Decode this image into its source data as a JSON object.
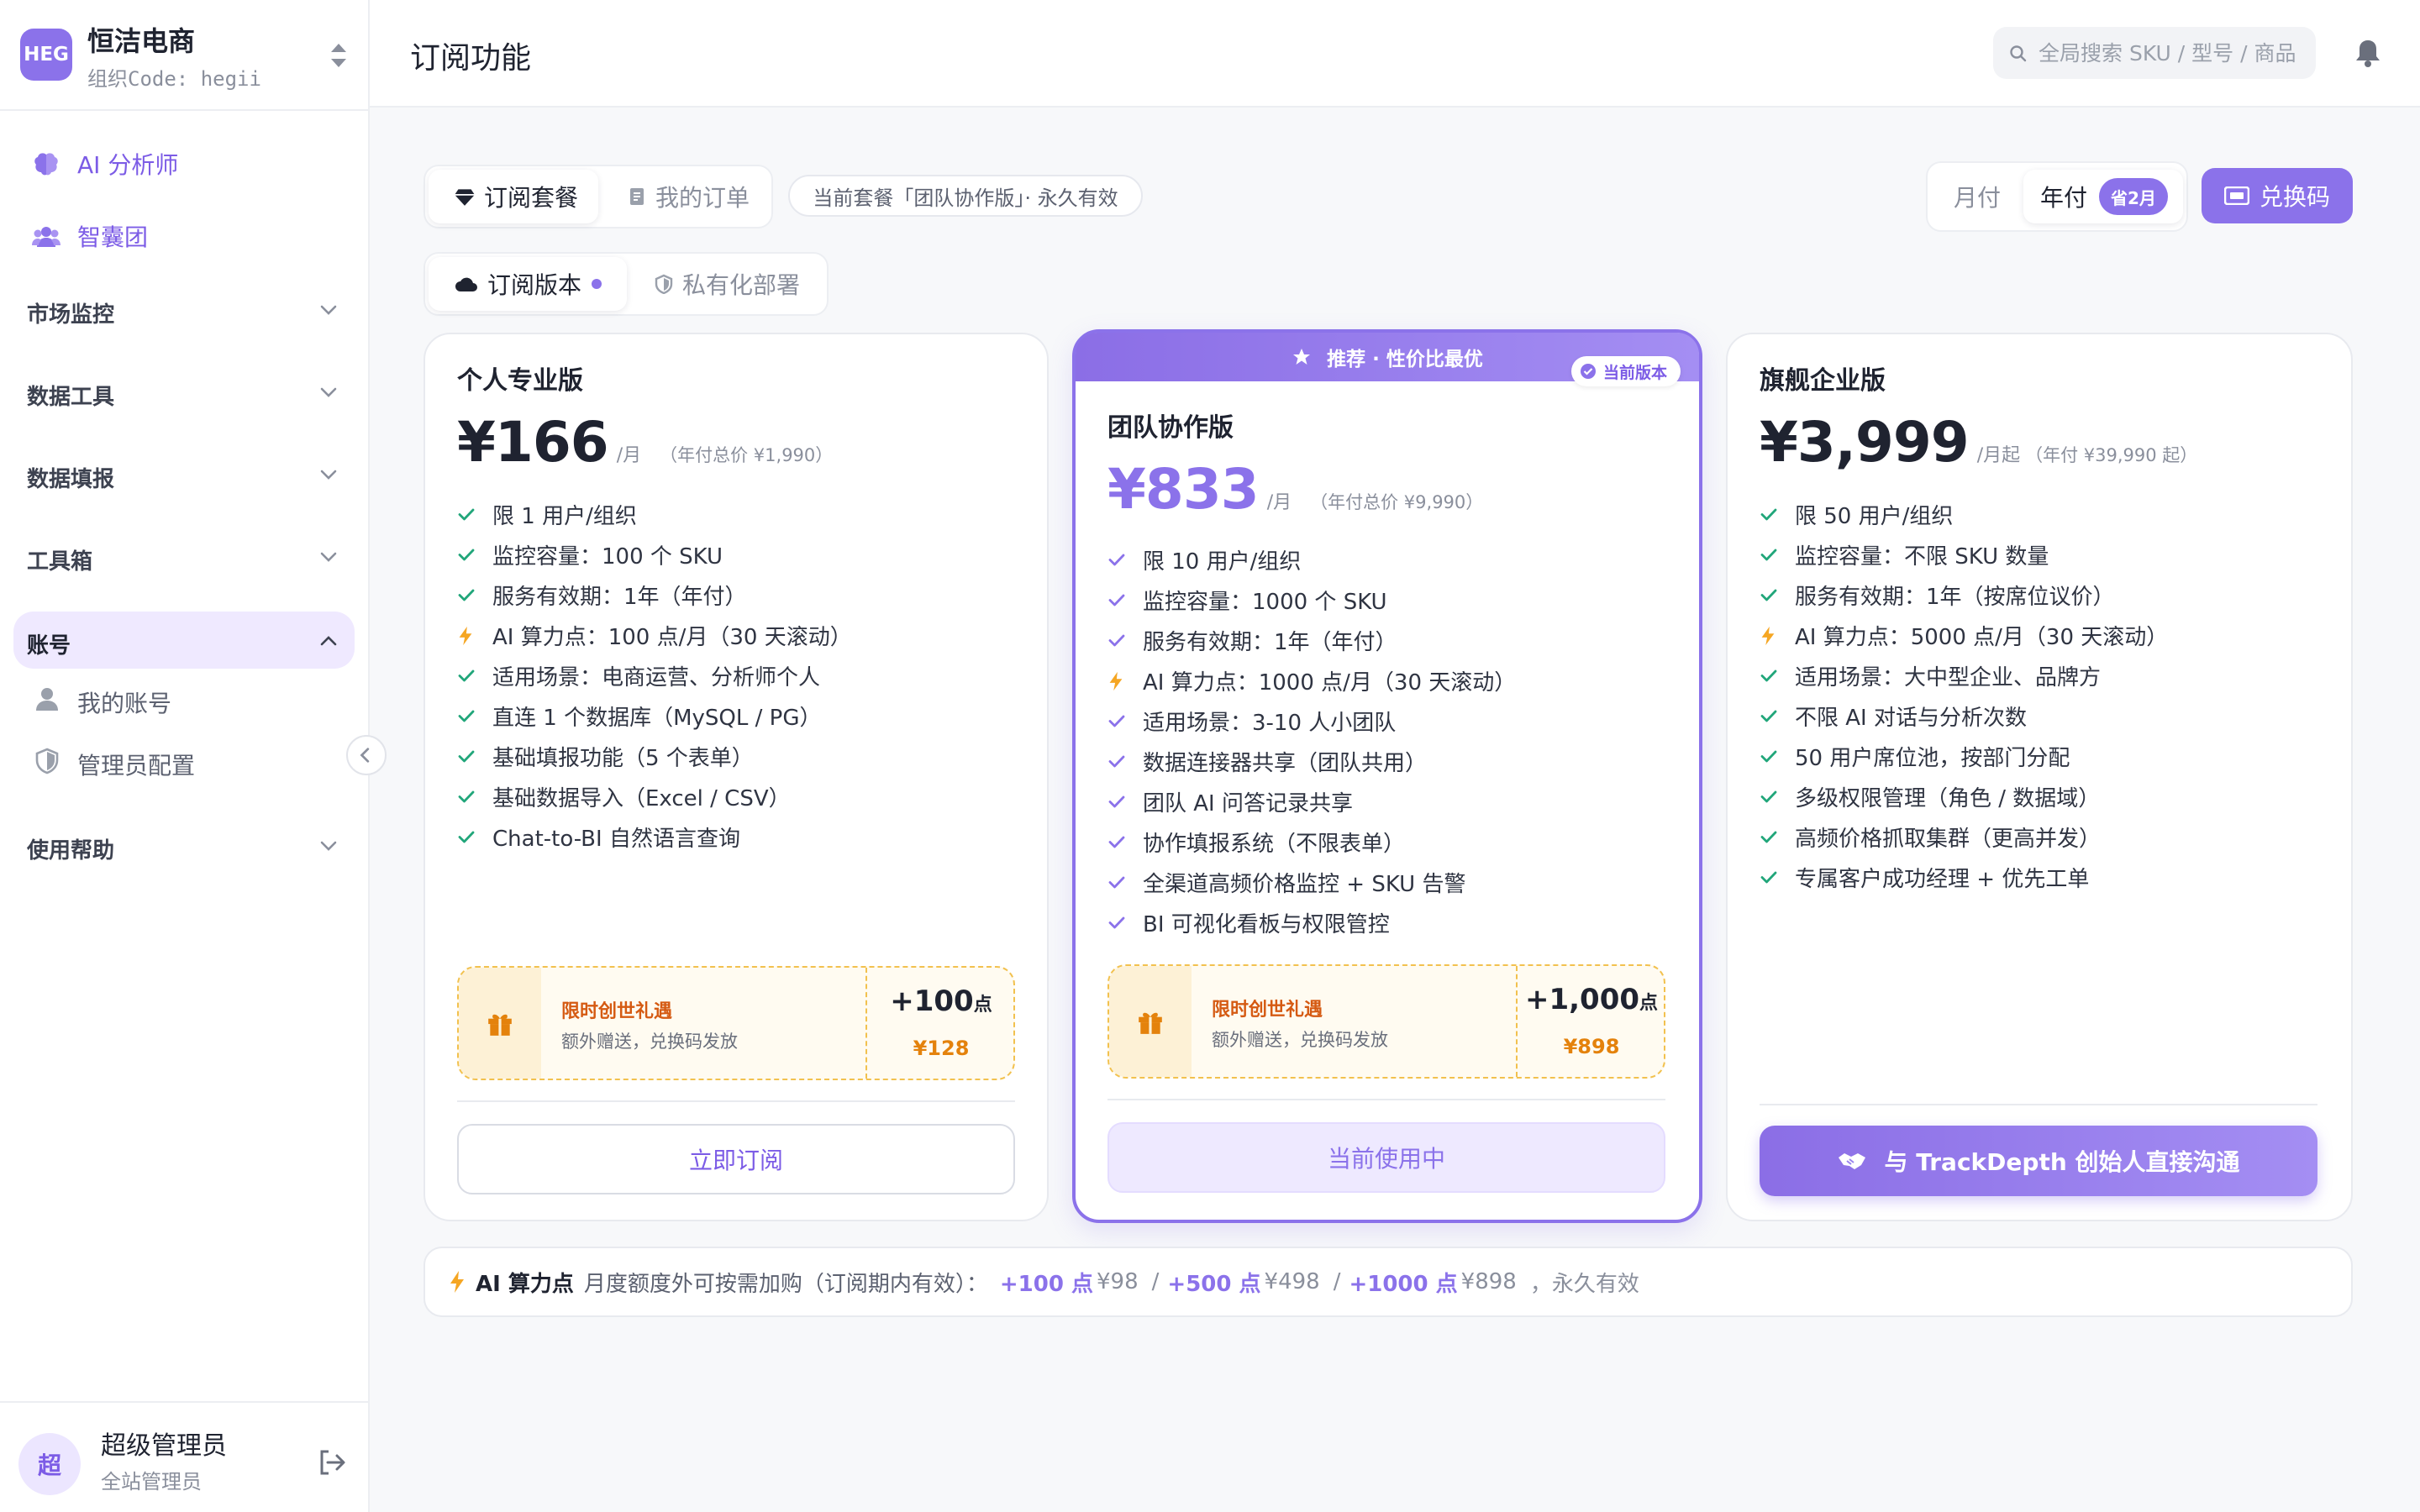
{
  "org": {
    "avatar": "HEG",
    "name": "恒洁电商",
    "code": "组织Code: hegii"
  },
  "nav": {
    "ai_analyst": "AI 分析师",
    "think_tank": "智囊团",
    "groups": {
      "market": "市场监控",
      "data_tools": "数据工具",
      "data_fill": "数据填报",
      "toolbox": "工具箱",
      "account": "账号",
      "help": "使用帮助"
    },
    "account_items": [
      "我的账号",
      "管理员配置"
    ]
  },
  "user": {
    "avatar": "超",
    "name": "超级管理员",
    "role": "全站管理员"
  },
  "header": {
    "title": "订阅功能",
    "search_placeholder": "全局搜索 SKU / 型号 / 商品"
  },
  "toolbar": {
    "tab_plans": "订阅套餐",
    "tab_orders": "我的订单",
    "current_plan": "当前套餐「团队协作版」· 永久有效",
    "billing_monthly": "月付",
    "billing_yearly": "年付",
    "save_badge": "省2月",
    "redeem": "兑换码",
    "version_cloud": "订阅版本",
    "version_private": "私有化部署"
  },
  "plans": [
    {
      "name": "个人专业版",
      "price": "¥166",
      "per": "/月",
      "total": "（年付总价 ¥1,990）",
      "features": [
        "限 1 用户/组织",
        "监控容量：100 个 SKU",
        "服务有效期：1年（年付）",
        "AI 算力点：100 点/月（30 天滚动）",
        "适用场景：电商运营、分析师个人",
        "直连 1 个数据库（MySQL / PG）",
        "基础填报功能（5 个表单）",
        "基础数据导入（Excel / CSV）",
        "Chat-to-BI 自然语言查询"
      ],
      "gift": {
        "title": "限时创世礼遇",
        "sub": "额外赠送，兑换码发放",
        "points": "+100",
        "unit": "点",
        "value": "¥128"
      },
      "cta": "立即订阅"
    },
    {
      "name": "团队协作版",
      "ribbon": "推荐 · 性价比最优",
      "current_tag": "当前版本",
      "price": "¥833",
      "per": "/月",
      "total": "（年付总价 ¥9,990）",
      "features": [
        "限 10 用户/组织",
        "监控容量：1000 个 SKU",
        "服务有效期：1年（年付）",
        "AI 算力点：1000 点/月（30 天滚动）",
        "适用场景：3-10 人小团队",
        "数据连接器共享（团队共用）",
        "团队 AI 问答记录共享",
        "协作填报系统（不限表单）",
        "全渠道高频价格监控 + SKU 告警",
        "BI 可视化看板与权限管控"
      ],
      "gift": {
        "title": "限时创世礼遇",
        "sub": "额外赠送，兑换码发放",
        "points": "+1,000",
        "unit": "点",
        "value": "¥898"
      },
      "cta": "当前使用中"
    },
    {
      "name": "旗舰企业版",
      "price": "¥3,999",
      "per": "/月起",
      "total": "（年付 ¥39,990 起）",
      "features": [
        "限 50 用户/组织",
        "监控容量：不限 SKU 数量",
        "服务有效期：1年（按席位议价）",
        "AI 算力点：5000 点/月（30 天滚动）",
        "适用场景：大中型企业、品牌方",
        "不限 AI 对话与分析次数",
        "50 用户席位池，按部门分配",
        "多级权限管理（角色 / 数据域）",
        "高频价格抓取集群（更高并发）",
        "专属客户成功经理 + 优先工单"
      ],
      "cta": "与 TrackDepth 创始人直接沟通"
    }
  ],
  "addon": {
    "title": "AI 算力点",
    "desc": "月度额度外可按需加购（订阅期内有效）：",
    "opt1_pts": "+100 点",
    "opt1_price": "¥98",
    "sep": "/",
    "opt2_pts": "+500 点",
    "opt2_price": "¥498",
    "opt3_pts": "+1000 点",
    "opt3_price": "¥898",
    "tail": "，永久有效"
  },
  "colors": {
    "accent": "#8b72ea",
    "check": "#21a67a",
    "bolt": "#f5a623",
    "gift": "#e4820c"
  }
}
